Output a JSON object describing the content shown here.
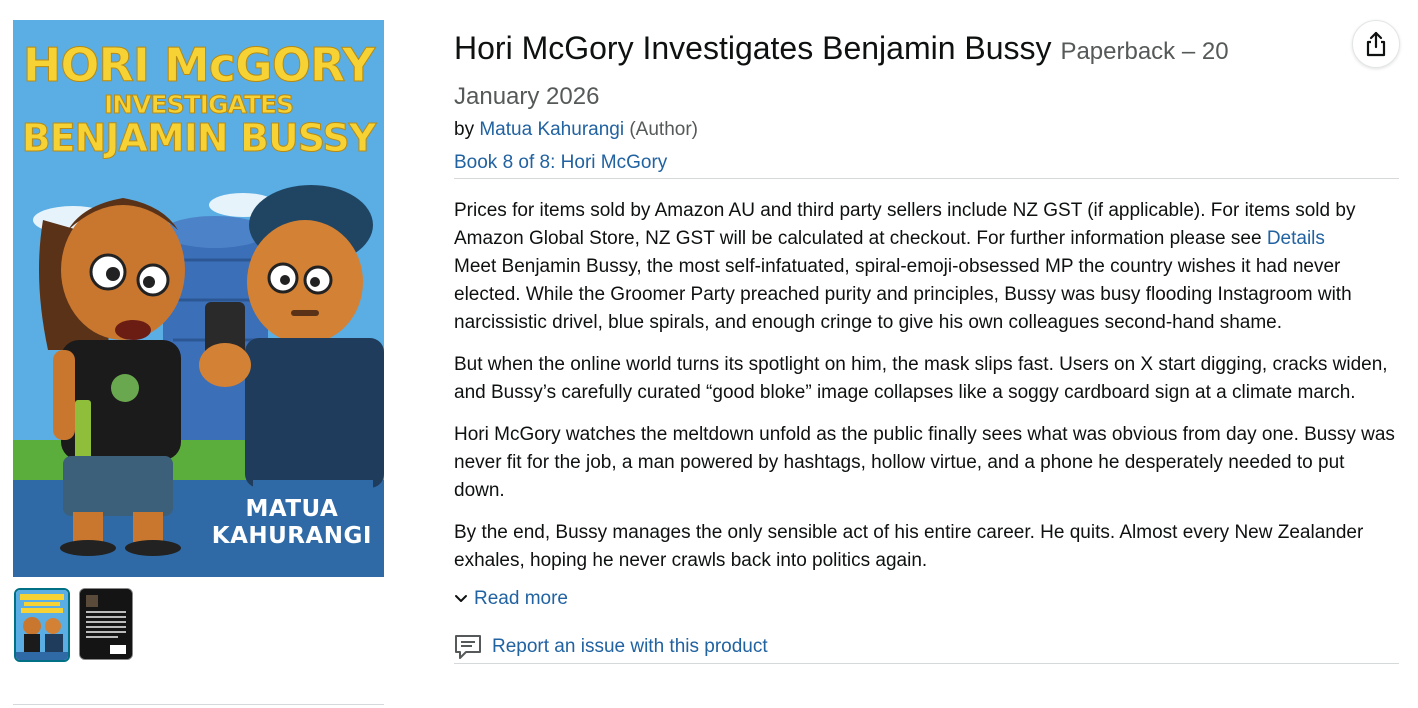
{
  "product": {
    "title": "Hori McGory Investigates Benjamin Bussy",
    "format": "Paperback – 20",
    "date": "January 2026",
    "by_prefix": "by",
    "author": "Matua Kahurangi",
    "author_role": "(Author)",
    "series": "Book 8 of 8: Hori McGory"
  },
  "cover": {
    "title_line1": "HORI McGORY",
    "title_line2": "INVESTIGATES",
    "title_line3": "BENJAMIN BUSSY",
    "author_line1": "MATUA",
    "author_line2": "KAHURANGI"
  },
  "description": {
    "gst_notice": "Prices for items sold by Amazon AU and third party sellers include NZ GST (if applicable). For items sold by Amazon Global Store, NZ GST will be calculated at checkout. For further information please see",
    "details_link": "Details",
    "paragraph1": "Meet Benjamin Bussy, the most self-infatuated, spiral-emoji-obsessed MP the country wishes it had never elected. While the Groomer Party preached purity and principles, Bussy was busy flooding Instagroom with narcissistic drivel, blue spirals, and enough cringe to give his own colleagues second-hand shame.",
    "paragraph2": "But when the online world turns its spotlight on him, the mask slips fast. Users on X start digging, cracks widen, and Bussy’s carefully curated “good bloke” image collapses like a soggy cardboard sign at a climate march.",
    "paragraph3": "Hori McGory watches the meltdown unfold as the public finally sees what was obvious from day one. Bussy was never fit for the job, a man powered by hashtags, hollow virtue, and a phone he desperately needed to put down.",
    "paragraph4": "By the end, Bussy manages the only sensible act of his entire career. He quits. Almost every New Zealander exhales, hoping he never crawls back into politics again."
  },
  "actions": {
    "read_more": "Read more",
    "report_issue": "Report an issue with this product"
  },
  "icons": {
    "share": "share-icon",
    "chevron": "chevron-down-icon",
    "report": "report-comment-icon"
  },
  "colors": {
    "link": "#2162a1",
    "muted": "#565959",
    "thumb_selected": "#007185",
    "cover_sky": "#5aaee4",
    "cover_title": "#f7d234"
  }
}
